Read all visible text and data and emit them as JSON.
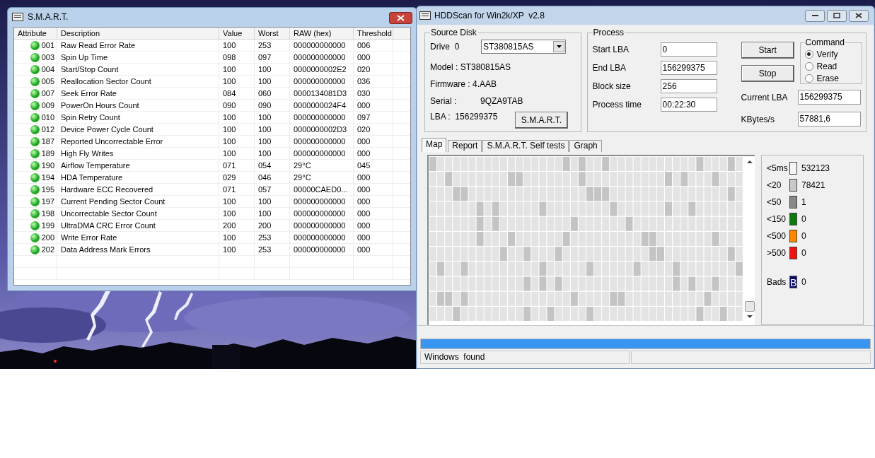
{
  "smart_window": {
    "title": "S.M.A.R.T.",
    "columns": [
      "Attribute",
      "Description",
      "Value",
      "Worst",
      "RAW (hex)",
      "Threshold"
    ],
    "rows": [
      {
        "color": "#1fa51f",
        "attribute": "001",
        "description": "Raw Read Error Rate",
        "value": "100",
        "worst": "253",
        "raw": "000000000000",
        "threshold": "006"
      },
      {
        "color": "#1fa51f",
        "attribute": "003",
        "description": "Spin Up Time",
        "value": "098",
        "worst": "097",
        "raw": "000000000000",
        "threshold": "000"
      },
      {
        "color": "#1fa51f",
        "attribute": "004",
        "description": "Start/Stop Count",
        "value": "100",
        "worst": "100",
        "raw": "0000000002E2",
        "threshold": "020"
      },
      {
        "color": "#1fa51f",
        "attribute": "005",
        "description": "Reallocation Sector Count",
        "value": "100",
        "worst": "100",
        "raw": "000000000000",
        "threshold": "036"
      },
      {
        "color": "#1fa51f",
        "attribute": "007",
        "description": "Seek Error Rate",
        "value": "084",
        "worst": "060",
        "raw": "0000134081D3",
        "threshold": "030"
      },
      {
        "color": "#1fa51f",
        "attribute": "009",
        "description": "PowerOn Hours Count",
        "value": "090",
        "worst": "090",
        "raw": "0000000024F4",
        "threshold": "000"
      },
      {
        "color": "#1fa51f",
        "attribute": "010",
        "description": "Spin Retry Count",
        "value": "100",
        "worst": "100",
        "raw": "000000000000",
        "threshold": "097"
      },
      {
        "color": "#1fa51f",
        "attribute": "012",
        "description": "Device Power Cycle Count",
        "value": "100",
        "worst": "100",
        "raw": "0000000002D3",
        "threshold": "020"
      },
      {
        "color": "#1fa51f",
        "attribute": "187",
        "description": "Reported Uncorrectable Error",
        "value": "100",
        "worst": "100",
        "raw": "000000000000",
        "threshold": "000"
      },
      {
        "color": "#1fa51f",
        "attribute": "189",
        "description": "High Fly Writes",
        "value": "100",
        "worst": "100",
        "raw": "000000000000",
        "threshold": "000"
      },
      {
        "color": "#1fa51f",
        "attribute": "190",
        "description": "Airflow Temperature",
        "value": "071",
        "worst": "054",
        "raw": "29°C",
        "threshold": "045"
      },
      {
        "color": "#1fa51f",
        "attribute": "194",
        "description": "HDA Temperature",
        "value": "029",
        "worst": "046",
        "raw": "29°C",
        "threshold": "000"
      },
      {
        "color": "#1fa51f",
        "attribute": "195",
        "description": "Hardware ECC Recovered",
        "value": "071",
        "worst": "057",
        "raw": "00000CAED0...",
        "threshold": "000"
      },
      {
        "color": "#1fa51f",
        "attribute": "197",
        "description": "Current Pending Sector Count",
        "value": "100",
        "worst": "100",
        "raw": "000000000000",
        "threshold": "000"
      },
      {
        "color": "#1fa51f",
        "attribute": "198",
        "description": "Uncorrectable Sector Count",
        "value": "100",
        "worst": "100",
        "raw": "000000000000",
        "threshold": "000"
      },
      {
        "color": "#1fa51f",
        "attribute": "199",
        "description": "UltraDMA CRC Error Count",
        "value": "200",
        "worst": "200",
        "raw": "000000000000",
        "threshold": "000"
      },
      {
        "color": "#1fa51f",
        "attribute": "200",
        "description": "Write Error Rate",
        "value": "100",
        "worst": "253",
        "raw": "000000000000",
        "threshold": "000"
      },
      {
        "color": "#1fa51f",
        "attribute": "202",
        "description": "Data Address Mark Errors",
        "value": "100",
        "worst": "253",
        "raw": "000000000000",
        "threshold": "000"
      }
    ]
  },
  "hddscan_window": {
    "title": "HDDScan for Win2k/XP  v2.8",
    "source_disk": {
      "legend": "Source Disk",
      "drive_label": "Drive  0",
      "drive_select": "ST380815AS",
      "model": "Model : ST380815AS",
      "firmware": "Firmware : 4.AAB",
      "serial_label": "Serial :",
      "serial": "9QZA9TAB",
      "lba": "LBA :  156299375",
      "smart_button": "S.M.A.R.T."
    },
    "process": {
      "legend": "Process",
      "fields": [
        {
          "label": "Start LBA",
          "value": "0"
        },
        {
          "label": "End LBA",
          "value": "156299375"
        },
        {
          "label": "Block size",
          "value": "256"
        },
        {
          "label": "Process time",
          "value": "00:22:30"
        }
      ],
      "buttons": [
        "Start",
        "Stop"
      ],
      "command": {
        "legend": "Command",
        "options": [
          {
            "label": "Verify",
            "selected": true
          },
          {
            "label": "Read",
            "selected": false
          },
          {
            "label": "Erase",
            "selected": false
          }
        ]
      },
      "current_lba": {
        "label": "Current LBA",
        "value": "156299375"
      },
      "kbytes": {
        "label": "KBytes/s",
        "value": "57881,6"
      }
    },
    "tabs": [
      {
        "label": "Map",
        "selected": true
      },
      {
        "label": "Report",
        "selected": false
      },
      {
        "label": "S.M.A.R.T. Self tests",
        "selected": false
      },
      {
        "label": "Graph",
        "selected": false
      }
    ],
    "legend": [
      {
        "label": "<5ms",
        "count": "532123",
        "color": "#f4f4f4"
      },
      {
        "label": "<20",
        "count": "78421",
        "color": "#c8c8c8"
      },
      {
        "label": "<50",
        "count": "1",
        "color": "#888888"
      },
      {
        "label": "<150",
        "count": "0",
        "color": "#107810"
      },
      {
        "label": "<500",
        "count": "0",
        "color": "#ff8800"
      },
      {
        "label": ">500",
        "count": "0",
        "color": "#ee1111"
      }
    ],
    "bads": {
      "label": "Bads",
      "mark": "B",
      "count": "0"
    },
    "progress": {
      "level": 1
    },
    "status_bar": {
      "message": "Windows  found"
    }
  }
}
